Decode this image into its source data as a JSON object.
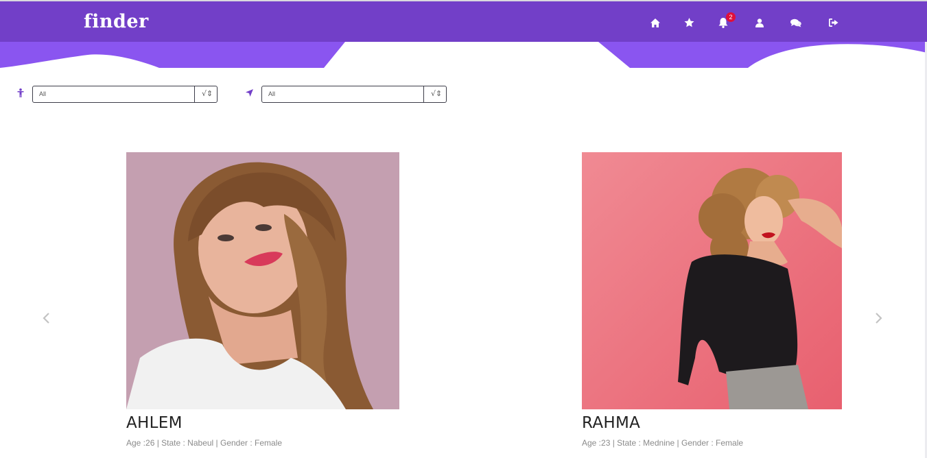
{
  "app": {
    "brand": "finder"
  },
  "nav": {
    "items": [
      {
        "icon": "home-icon"
      },
      {
        "icon": "star-icon"
      },
      {
        "icon": "bell-icon",
        "badge": "2"
      },
      {
        "icon": "user-icon"
      },
      {
        "icon": "chat-icon"
      },
      {
        "icon": "logout-icon"
      }
    ]
  },
  "filters": {
    "gender": {
      "icon": "person-icon",
      "value": "All",
      "arrow": "√⇕"
    },
    "location": {
      "icon": "location-arrow-icon",
      "value": "All",
      "arrow": "√⇕"
    }
  },
  "profiles": [
    {
      "name": "AHLEM",
      "details": "Age :26 | State : Nabeul | Gender : Female"
    },
    {
      "name": "RAHMA",
      "details": "Age :23 | State : Mednine | Gender : Female"
    }
  ],
  "colors": {
    "navbar": "#723fc8",
    "wave": "#8a55f0",
    "badge": "#e0103a"
  }
}
